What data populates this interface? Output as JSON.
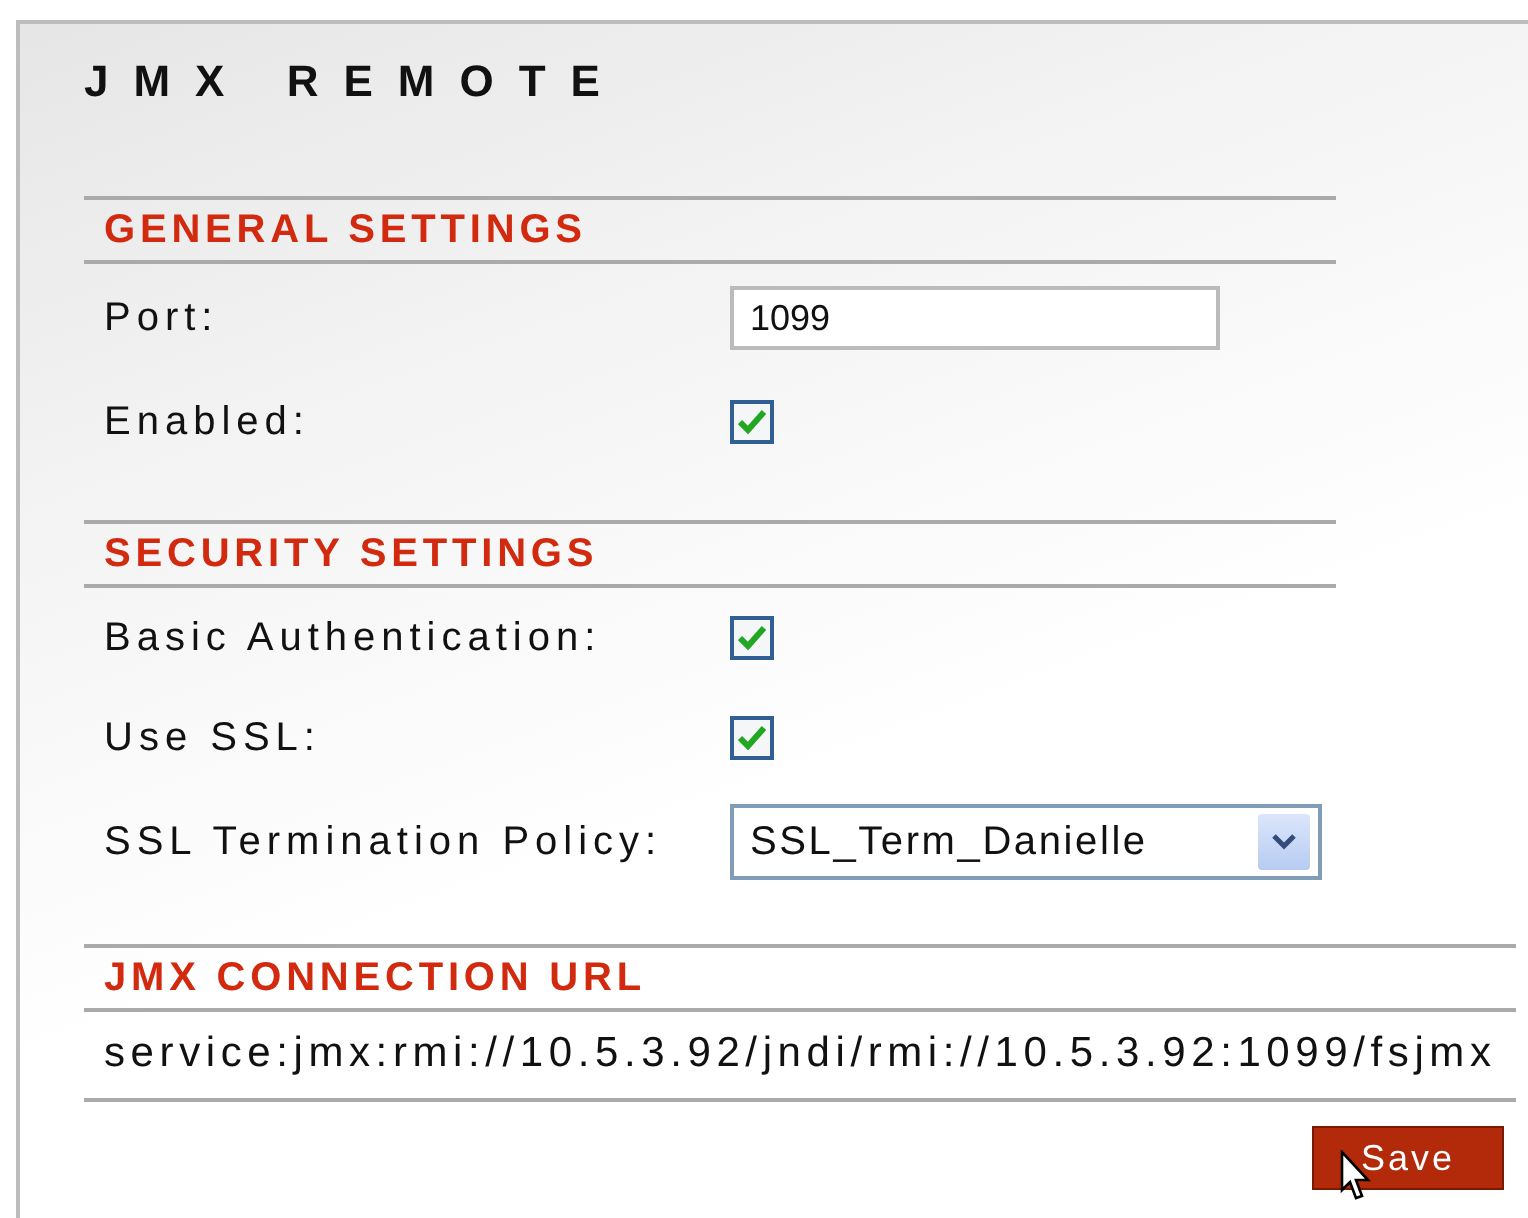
{
  "title": "JMX REMOTE",
  "sections": [
    {
      "heading": "GENERAL SETTINGS",
      "fields": [
        {
          "kind": "text",
          "label": "Port:",
          "value": "1099"
        },
        {
          "kind": "checkbox",
          "label": "Enabled:",
          "checked": true
        }
      ]
    },
    {
      "heading": "SECURITY SETTINGS",
      "fields": [
        {
          "kind": "checkbox",
          "label": "Basic Authentication:",
          "checked": true
        },
        {
          "kind": "checkbox",
          "label": "Use SSL:",
          "checked": true
        },
        {
          "kind": "select",
          "label": "SSL Termination Policy:",
          "value": "SSL_Term_Danielle"
        }
      ]
    },
    {
      "heading": "JMX CONNECTION URL",
      "fields": [
        {
          "kind": "info",
          "value": "service:jmx:rmi://10.5.3.92/jndi/rmi://10.5.3.92:1099/fsjmx"
        }
      ]
    }
  ],
  "save_button": {
    "label": "Save"
  }
}
